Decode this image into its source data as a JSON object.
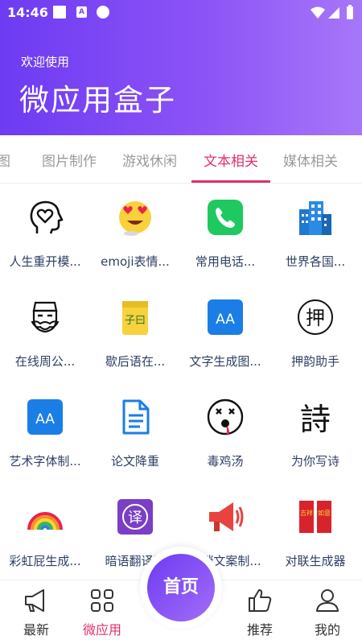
{
  "status_bar": {
    "time": "14:46",
    "a_icon_letter": "A"
  },
  "header": {
    "welcome": "欢迎使用",
    "title": "微应用盒子"
  },
  "tabs": [
    {
      "label": "图"
    },
    {
      "label": "图片制作"
    },
    {
      "label": "游戏休闲"
    },
    {
      "label": "文本相关"
    },
    {
      "label": "媒体相关"
    }
  ],
  "active_tab_index": 3,
  "grid": [
    {
      "label": "人生重开模...",
      "icon": "head-heart-icon"
    },
    {
      "label": "emoji表情...",
      "icon": "emoji-love-icon"
    },
    {
      "label": "常用电话...",
      "icon": "phone-icon"
    },
    {
      "label": "世界各国...",
      "icon": "buildings-icon"
    },
    {
      "label": "在线周公...",
      "icon": "sage-face-icon"
    },
    {
      "label": "歇后语在...",
      "icon": "notebook-icon",
      "icon_text": "子曰"
    },
    {
      "label": "文字生成图...",
      "icon": "font-aa-icon",
      "icon_text": "AA"
    },
    {
      "label": "押韵助手",
      "icon": "rhyme-icon",
      "icon_text": "押"
    },
    {
      "label": "艺术字体制...",
      "icon": "font-aa-icon",
      "icon_text": "AA"
    },
    {
      "label": "论文降重",
      "icon": "document-icon"
    },
    {
      "label": "毒鸡汤",
      "icon": "dizzy-face-icon"
    },
    {
      "label": "为你写诗",
      "icon": "poem-icon",
      "icon_text": "詩"
    },
    {
      "label": "彩虹屁生成...",
      "icon": "rainbow-icon"
    },
    {
      "label": "暗语翻译器",
      "icon": "translate-icon",
      "icon_text": "译"
    },
    {
      "label": "营销文案制...",
      "icon": "megaphone-icon"
    },
    {
      "label": "对联生成器",
      "icon": "couplet-icon",
      "icon_text": [
        "吉祥",
        "如意"
      ]
    }
  ],
  "bottom_nav": {
    "latest": "最新",
    "micro_apps": "微应用",
    "home": "首页",
    "recommend": "推荐",
    "mine": "我的"
  },
  "colors": {
    "header_gradient_start": "#6d3bf2",
    "header_gradient_end": "#a777f9",
    "accent": "#e0306e",
    "label_text": "#2f3f63"
  }
}
